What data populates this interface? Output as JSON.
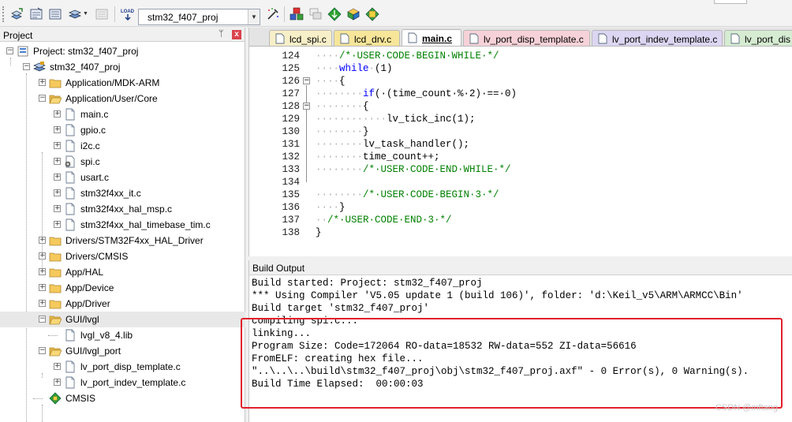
{
  "toolbar": {
    "target": "stm32_f407_proj",
    "load_icon_text": "LOAD"
  },
  "project": {
    "title": "Project",
    "pin": "ᛘ",
    "close": "x",
    "tree": [
      {
        "label": "Project: stm32_f407_proj",
        "level": 0,
        "exp": "−",
        "icon": "project"
      },
      {
        "label": "stm32_f407_proj",
        "level": 1,
        "exp": "−",
        "icon": "target"
      },
      {
        "label": "Application/MDK-ARM",
        "level": 2,
        "exp": "+",
        "icon": "folder"
      },
      {
        "label": "Application/User/Core",
        "level": 2,
        "exp": "−",
        "icon": "folder-open"
      },
      {
        "label": "main.c",
        "level": 3,
        "exp": "+",
        "icon": "file"
      },
      {
        "label": "gpio.c",
        "level": 3,
        "exp": "+",
        "icon": "file"
      },
      {
        "label": "i2c.c",
        "level": 3,
        "exp": "+",
        "icon": "file"
      },
      {
        "label": "spi.c",
        "level": 3,
        "exp": "+",
        "icon": "file-gear"
      },
      {
        "label": "usart.c",
        "level": 3,
        "exp": "+",
        "icon": "file"
      },
      {
        "label": "stm32f4xx_it.c",
        "level": 3,
        "exp": "+",
        "icon": "file"
      },
      {
        "label": "stm32f4xx_hal_msp.c",
        "level": 3,
        "exp": "+",
        "icon": "file"
      },
      {
        "label": "stm32f4xx_hal_timebase_tim.c",
        "level": 3,
        "exp": "+",
        "icon": "file"
      },
      {
        "label": "Drivers/STM32F4xx_HAL_Driver",
        "level": 2,
        "exp": "+",
        "icon": "folder"
      },
      {
        "label": "Drivers/CMSIS",
        "level": 2,
        "exp": "+",
        "icon": "folder"
      },
      {
        "label": "App/HAL",
        "level": 2,
        "exp": "+",
        "icon": "folder"
      },
      {
        "label": "App/Device",
        "level": 2,
        "exp": "+",
        "icon": "folder"
      },
      {
        "label": "App/Driver",
        "level": 2,
        "exp": "+",
        "icon": "folder"
      },
      {
        "label": "GUI/lvgl",
        "level": 2,
        "exp": "−",
        "icon": "folder-open",
        "selected": true
      },
      {
        "label": "lvgl_v8_4.lib",
        "level": 3,
        "exp": "",
        "icon": "file"
      },
      {
        "label": "GUI/lvgl_port",
        "level": 2,
        "exp": "−",
        "icon": "folder-open"
      },
      {
        "label": "lv_port_disp_template.c",
        "level": 3,
        "exp": "+",
        "icon": "file"
      },
      {
        "label": "lv_port_indev_template.c",
        "level": 3,
        "exp": "+",
        "icon": "file"
      },
      {
        "label": "CMSIS",
        "level": 2,
        "exp": "",
        "icon": "diamond"
      }
    ]
  },
  "editor": {
    "tabs": [
      {
        "label": "lcd_spi.c",
        "color": "#f7efc8",
        "active": false
      },
      {
        "label": "lcd_drv.c",
        "color": "#f7e69a",
        "active": false
      },
      {
        "label": "main.c",
        "color": "#dde8b8",
        "active": true
      },
      {
        "label": "lv_port_disp_template.c",
        "color": "#f6d2d8",
        "active": false
      },
      {
        "label": "lv_port_indev_template.c",
        "color": "#dcd6f2",
        "active": false
      },
      {
        "label": "lv_port_dis",
        "color": "#d6ecd2",
        "active": false
      }
    ],
    "lines": [
      {
        "n": "124",
        "fold": "",
        "segs": [
          {
            "t": "····",
            "c": "ws"
          },
          {
            "t": "/*·USER·CODE·BEGIN·WHILE·*/",
            "c": "cm"
          }
        ]
      },
      {
        "n": "125",
        "fold": "",
        "segs": [
          {
            "t": "····",
            "c": "ws"
          },
          {
            "t": "while",
            "c": "kw"
          },
          {
            "t": "·",
            "c": "ws"
          },
          {
            "t": "(1)",
            "c": ""
          }
        ]
      },
      {
        "n": "126",
        "fold": "−",
        "segs": [
          {
            "t": "····",
            "c": "ws"
          },
          {
            "t": "{",
            "c": ""
          }
        ]
      },
      {
        "n": "127",
        "fold": "",
        "segs": [
          {
            "t": "········",
            "c": "ws"
          },
          {
            "t": "if",
            "c": "kw"
          },
          {
            "t": "(·(time_count·%·2)·==·0)",
            "c": ""
          }
        ]
      },
      {
        "n": "128",
        "fold": "−",
        "segs": [
          {
            "t": "········",
            "c": "ws"
          },
          {
            "t": "{",
            "c": ""
          }
        ]
      },
      {
        "n": "129",
        "fold": "",
        "segs": [
          {
            "t": "············",
            "c": "ws"
          },
          {
            "t": "lv_tick_inc(1);",
            "c": ""
          }
        ]
      },
      {
        "n": "130",
        "fold": "",
        "segs": [
          {
            "t": "········",
            "c": "ws"
          },
          {
            "t": "}",
            "c": ""
          }
        ]
      },
      {
        "n": "131",
        "fold": "",
        "segs": [
          {
            "t": "········",
            "c": "ws"
          },
          {
            "t": "lv_task_handler();",
            "c": ""
          }
        ]
      },
      {
        "n": "132",
        "fold": "",
        "segs": [
          {
            "t": "········",
            "c": "ws"
          },
          {
            "t": "time_count++;",
            "c": ""
          }
        ]
      },
      {
        "n": "133",
        "fold": "",
        "segs": [
          {
            "t": "········",
            "c": "ws"
          },
          {
            "t": "/*·USER·CODE·END·WHILE·*/",
            "c": "cm"
          }
        ]
      },
      {
        "n": "134",
        "fold": "",
        "segs": []
      },
      {
        "n": "135",
        "fold": "",
        "segs": [
          {
            "t": "········",
            "c": "ws"
          },
          {
            "t": "/*·USER·CODE·BEGIN·3·*/",
            "c": "cm"
          }
        ]
      },
      {
        "n": "136",
        "fold": "",
        "segs": [
          {
            "t": "····",
            "c": "ws"
          },
          {
            "t": "}",
            "c": ""
          }
        ]
      },
      {
        "n": "137",
        "fold": "",
        "segs": [
          {
            "t": "··",
            "c": "ws"
          },
          {
            "t": "/*·USER·CODE·END·3·*/",
            "c": "cm"
          }
        ]
      },
      {
        "n": "138",
        "fold": "",
        "segs": [
          {
            "t": "}",
            "c": ""
          }
        ]
      }
    ]
  },
  "build": {
    "title": "Build Output",
    "lines": [
      "Build started: Project: stm32_f407_proj",
      "*** Using Compiler 'V5.05 update 1 (build 106)', folder: 'd:\\Keil_v5\\ARM\\ARMCC\\Bin'",
      "Build target 'stm32_f407_proj'",
      "compiling spi.c...",
      "linking...",
      "Program Size: Code=172064 RO-data=18532 RW-data=552 ZI-data=56616",
      "FromELF: creating hex file...",
      "\"..\\..\\..\\build\\stm32_f407_proj\\obj\\stm32_f407_proj.axf\" - 0 Error(s), 0 Warning(s).",
      "Build Time Elapsed:  00:00:03"
    ]
  },
  "watermark": "CSDN @mftang"
}
